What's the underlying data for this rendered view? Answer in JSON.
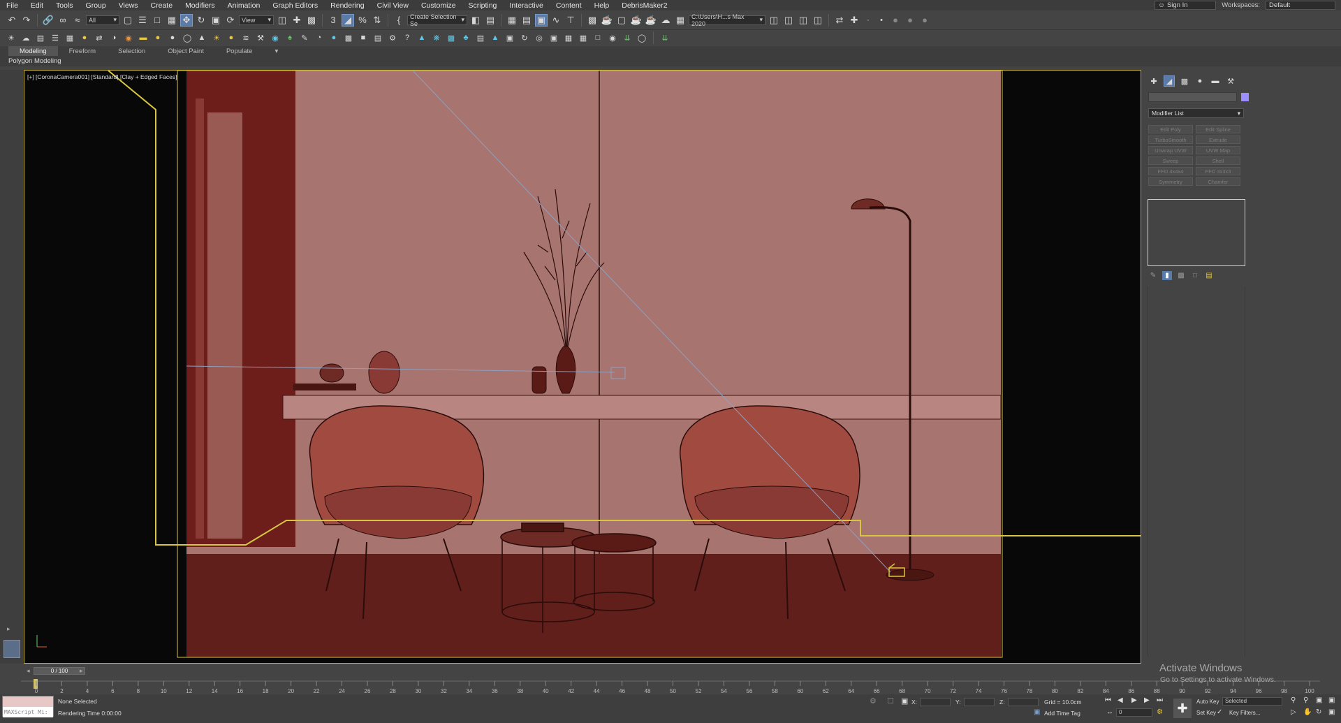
{
  "menu": {
    "items": [
      "File",
      "Edit",
      "Tools",
      "Group",
      "Views",
      "Create",
      "Modifiers",
      "Animation",
      "Graph Editors",
      "Rendering",
      "Civil View",
      "Customize",
      "Scripting",
      "Interactive",
      "Content",
      "Help",
      "DebrisMaker2"
    ],
    "sign_in": "Sign In",
    "workspaces_label": "Workspaces:",
    "workspace_value": "Default"
  },
  "toolbar": {
    "filter_all": "All",
    "ref_coord": "View",
    "create_selection_set": "Create Selection Se",
    "project_path": "C:\\Users\\H...s Max 2020"
  },
  "ribbon": {
    "tabs": [
      "Modeling",
      "Freeform",
      "Selection",
      "Object Paint",
      "Populate"
    ],
    "sub_label": "Polygon Modeling"
  },
  "viewport": {
    "label": "[+] [CoronaCamera001] [Standard] [Clay + Edged Faces]",
    "colors": {
      "wall": "#a87470",
      "wall_dark": "#6e1e1a",
      "floor": "#611f1c",
      "wire": "#2a0c0a",
      "frame": "#d8c640",
      "camera_line": "#8fa0c0"
    }
  },
  "command_panel": {
    "modifier_list": "Modifier List",
    "modifier_buttons": [
      "Edit Poly",
      "Edit Spline",
      "TurboSmooth",
      "Extrude",
      "Unwrap UVW",
      "UVW Map",
      "Sweep",
      "Shell",
      "FFD 4x4x4",
      "FFD 3x3x3",
      "Symmetry",
      "Chamfer"
    ]
  },
  "watermark": {
    "title": "Activate Windows",
    "subtitle": "Go to Settings to activate Windows."
  },
  "timeline": {
    "frame_display": "0 / 100",
    "ticks": [
      "0",
      "2",
      "4",
      "6",
      "8",
      "10",
      "12",
      "14",
      "16",
      "18",
      "20",
      "22",
      "24",
      "26",
      "28",
      "30",
      "32",
      "34",
      "36",
      "38",
      "40",
      "42",
      "44",
      "46",
      "48",
      "50",
      "52",
      "54",
      "56",
      "58",
      "60",
      "62",
      "64",
      "66",
      "68",
      "70",
      "72",
      "74",
      "76",
      "78",
      "80",
      "82",
      "84",
      "86",
      "88",
      "90",
      "92",
      "94",
      "96",
      "98",
      "100"
    ]
  },
  "status": {
    "maxscript": "MAXScript Mi:",
    "selection": "None Selected",
    "rendering_time": "Rendering Time  0:00:00",
    "x_label": "X:",
    "y_label": "Y:",
    "z_label": "Z:",
    "grid": "Grid = 10.0cm",
    "add_time_tag": "Add Time Tag",
    "auto_key": "Auto Key",
    "set_key": "Set Key",
    "selected": "Selected",
    "key_filters": "Key Filters...",
    "current_frame": "0"
  }
}
